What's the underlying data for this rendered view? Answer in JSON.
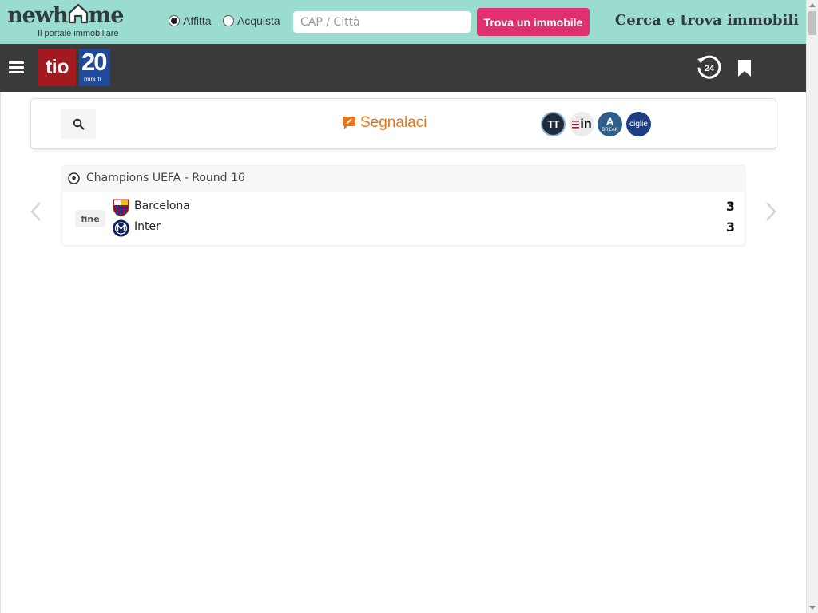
{
  "promo": {
    "brand_word_start": "newh",
    "brand_word_end": "me",
    "brand_tagline": "Il portale immobiliare",
    "radio_options": [
      {
        "label": "Affitta",
        "checked": true
      },
      {
        "label": "Acquista",
        "checked": false
      }
    ],
    "search_placeholder": "CAP / Città",
    "search_value": "",
    "find_button_label": "Trova un immobile",
    "slogan": "Cerca e trova immobili",
    "colors": {
      "background": "#9bdcd0",
      "button": "#e0306f"
    }
  },
  "navbar": {
    "logo_text": "tio",
    "logo_number": "20",
    "logo_sub": "minuti",
    "latest_news_badge": "24",
    "icons": [
      "hamburger-menu-icon",
      "latest-24-icon",
      "bookmark-icon"
    ],
    "colors": {
      "background": "#3a3a3a",
      "logo_red": "#a2191f",
      "logo_blue": "#1f4a9c"
    }
  },
  "toolbar": {
    "search_icon": "search-icon",
    "report_label": "Segnalaci",
    "report_color": "#e8751a",
    "partners": [
      {
        "name": "partner-tt-logo",
        "text": "TT"
      },
      {
        "name": "partner-in-logo",
        "text": "in"
      },
      {
        "name": "partner-break-logo",
        "text": "A",
        "sub": "BREAK"
      },
      {
        "name": "partner-ciglie-logo",
        "text": "ciglie"
      }
    ]
  },
  "match": {
    "competition": "Champions UEFA - Round 16",
    "status": "fine",
    "home": {
      "name": "Barcelona",
      "score": "3"
    },
    "away": {
      "name": "Inter",
      "score": "3"
    }
  }
}
